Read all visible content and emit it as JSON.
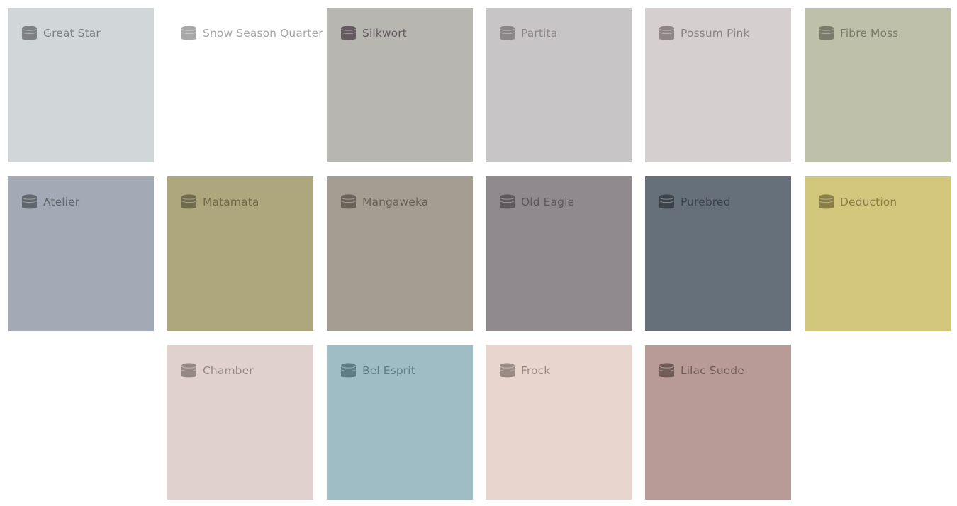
{
  "swatches": [
    {
      "name": "Great Star",
      "color": "#d1d6d9",
      "text_color": "#7d8184",
      "icon": "paint-can-icon"
    },
    {
      "name": "Snow Season Quarter",
      "color": "#ffffff",
      "text_color": "#a8a8a8",
      "icon": "paint-can-icon"
    },
    {
      "name": "Silkwort",
      "color": "#b8b6b1",
      "text_color": "#655a61",
      "icon": "paint-can-icon"
    },
    {
      "name": "Partita",
      "color": "#c8c5c6",
      "text_color": "#8a8587",
      "icon": "paint-can-icon"
    },
    {
      "name": "Possum Pink",
      "color": "#d6cfcf",
      "text_color": "#8d8586",
      "icon": "paint-can-icon"
    },
    {
      "name": "Fibre Moss",
      "color": "#bfc0aa",
      "text_color": "#7b7c6b",
      "icon": "paint-can-icon"
    },
    {
      "name": "Atelier",
      "color": "#a3aab5",
      "text_color": "#62676e",
      "icon": "paint-can-icon"
    },
    {
      "name": "Matamata",
      "color": "#aea67d",
      "text_color": "#6f6a4a",
      "icon": "paint-can-icon"
    },
    {
      "name": "Mangaweka",
      "color": "#a49d92",
      "text_color": "#6a6259",
      "icon": "paint-can-icon"
    },
    {
      "name": "Old Eagle",
      "color": "#908a8e",
      "text_color": "#5e585c",
      "icon": "paint-can-icon"
    },
    {
      "name": "Purebred",
      "color": "#66707b",
      "text_color": "#3c4249",
      "icon": "paint-can-icon"
    },
    {
      "name": "Deduction",
      "color": "#d3c67d",
      "text_color": "#8a7f46",
      "icon": "paint-can-icon"
    },
    {
      "name": "Chamber",
      "color": "#e0d1ce",
      "text_color": "#958985",
      "icon": "paint-can-icon"
    },
    {
      "name": "Bel Esprit",
      "color": "#9fbdc4",
      "text_color": "#5e7d84",
      "icon": "paint-can-icon"
    },
    {
      "name": "Frock",
      "color": "#e8d5ce",
      "text_color": "#9a8c85",
      "icon": "paint-can-icon"
    },
    {
      "name": "Lilac Suede",
      "color": "#b89b97",
      "text_color": "#725c58",
      "icon": "paint-can-icon"
    }
  ]
}
